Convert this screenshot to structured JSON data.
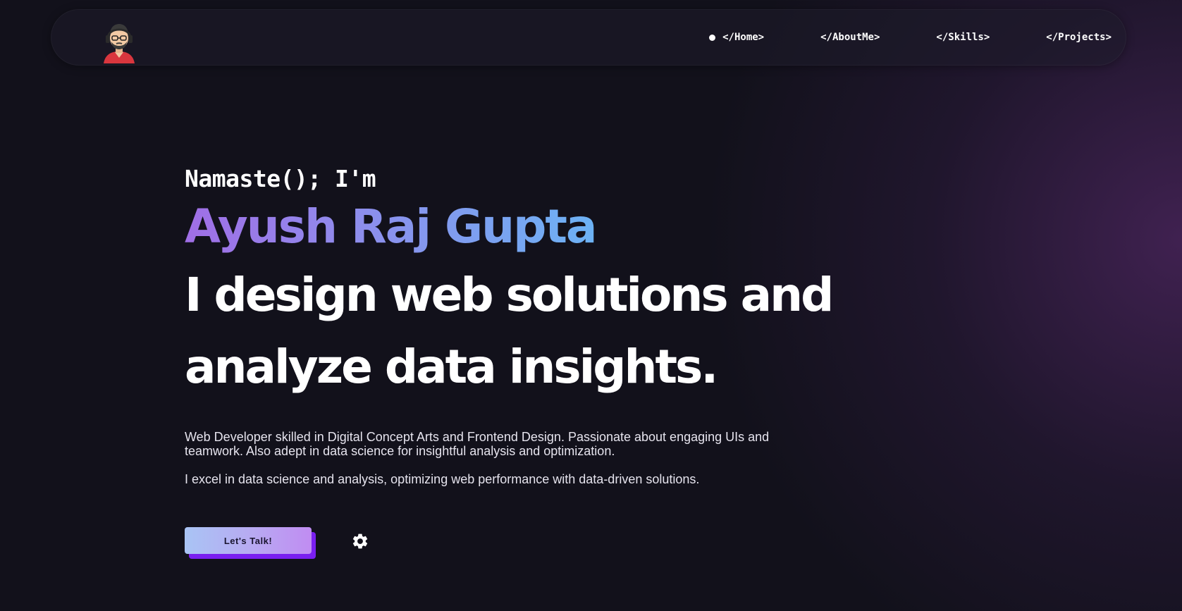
{
  "nav": {
    "logo_icon": "developer-avatar-icon",
    "items": [
      {
        "label": "</Home>",
        "active": true
      },
      {
        "label": "</AboutMe>",
        "active": false
      },
      {
        "label": "</Skills>",
        "active": false
      },
      {
        "label": "</Projects>",
        "active": false
      }
    ]
  },
  "hero": {
    "greeting": "Namaste(); I'm",
    "name": "Ayush Raj Gupta",
    "headline_line1": "I design web solutions and",
    "headline_line2": "analyze data insights.",
    "description_1": "Web Developer skilled in Digital Concept Arts and Frontend Design. Passionate about engaging UIs and teamwork. Also adept in data science for insightful analysis and optimization.",
    "description_2": "I excel in data science and analysis, optimizing web performance with data-driven solutions.",
    "cta_label": "Let's Talk!",
    "settings_icon": "gear-icon"
  },
  "colors": {
    "background": "#12111b",
    "name_gradient_start": "#a06ee6",
    "name_gradient_end": "#6cb2f4",
    "cta_shadow": "#7a1ff0",
    "text": "#ffffff"
  }
}
